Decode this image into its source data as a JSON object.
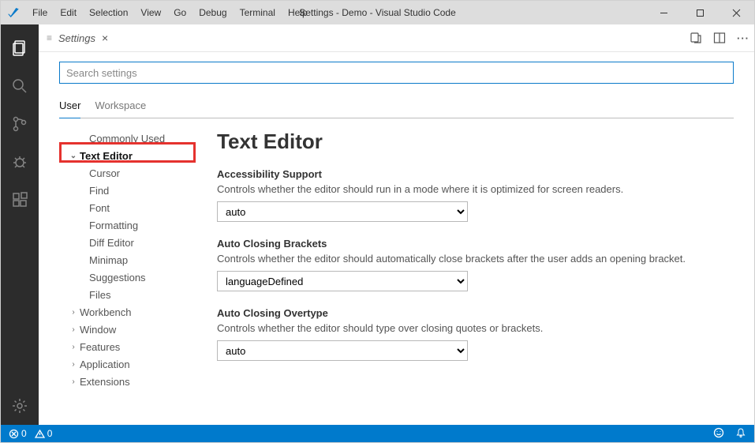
{
  "window_title": "Settings - Demo - Visual Studio Code",
  "menubar": [
    "File",
    "Edit",
    "Selection",
    "View",
    "Go",
    "Debug",
    "Terminal",
    "Help"
  ],
  "tab": {
    "title": "Settings"
  },
  "search": {
    "placeholder": "Search settings"
  },
  "scope_tabs": {
    "user": "User",
    "workspace": "Workspace"
  },
  "tree": {
    "commonly_used": "Commonly Used",
    "text_editor": "Text Editor",
    "children": {
      "cursor": "Cursor",
      "find": "Find",
      "font": "Font",
      "formatting": "Formatting",
      "diff_editor": "Diff Editor",
      "minimap": "Minimap",
      "suggestions": "Suggestions",
      "files": "Files"
    },
    "workbench": "Workbench",
    "window": "Window",
    "features": "Features",
    "application": "Application",
    "extensions": "Extensions"
  },
  "content": {
    "heading": "Text Editor",
    "accessibility": {
      "label": "Accessibility Support",
      "desc": "Controls whether the editor should run in a mode where it is optimized for screen readers.",
      "value": "auto"
    },
    "auto_closing_brackets": {
      "label": "Auto Closing Brackets",
      "desc": "Controls whether the editor should automatically close brackets after the user adds an opening bracket.",
      "value": "languageDefined"
    },
    "auto_closing_overtype": {
      "label": "Auto Closing Overtype",
      "desc": "Controls whether the editor should type over closing quotes or brackets.",
      "value": "auto"
    }
  },
  "statusbar": {
    "errors": "0",
    "warnings": "0"
  }
}
